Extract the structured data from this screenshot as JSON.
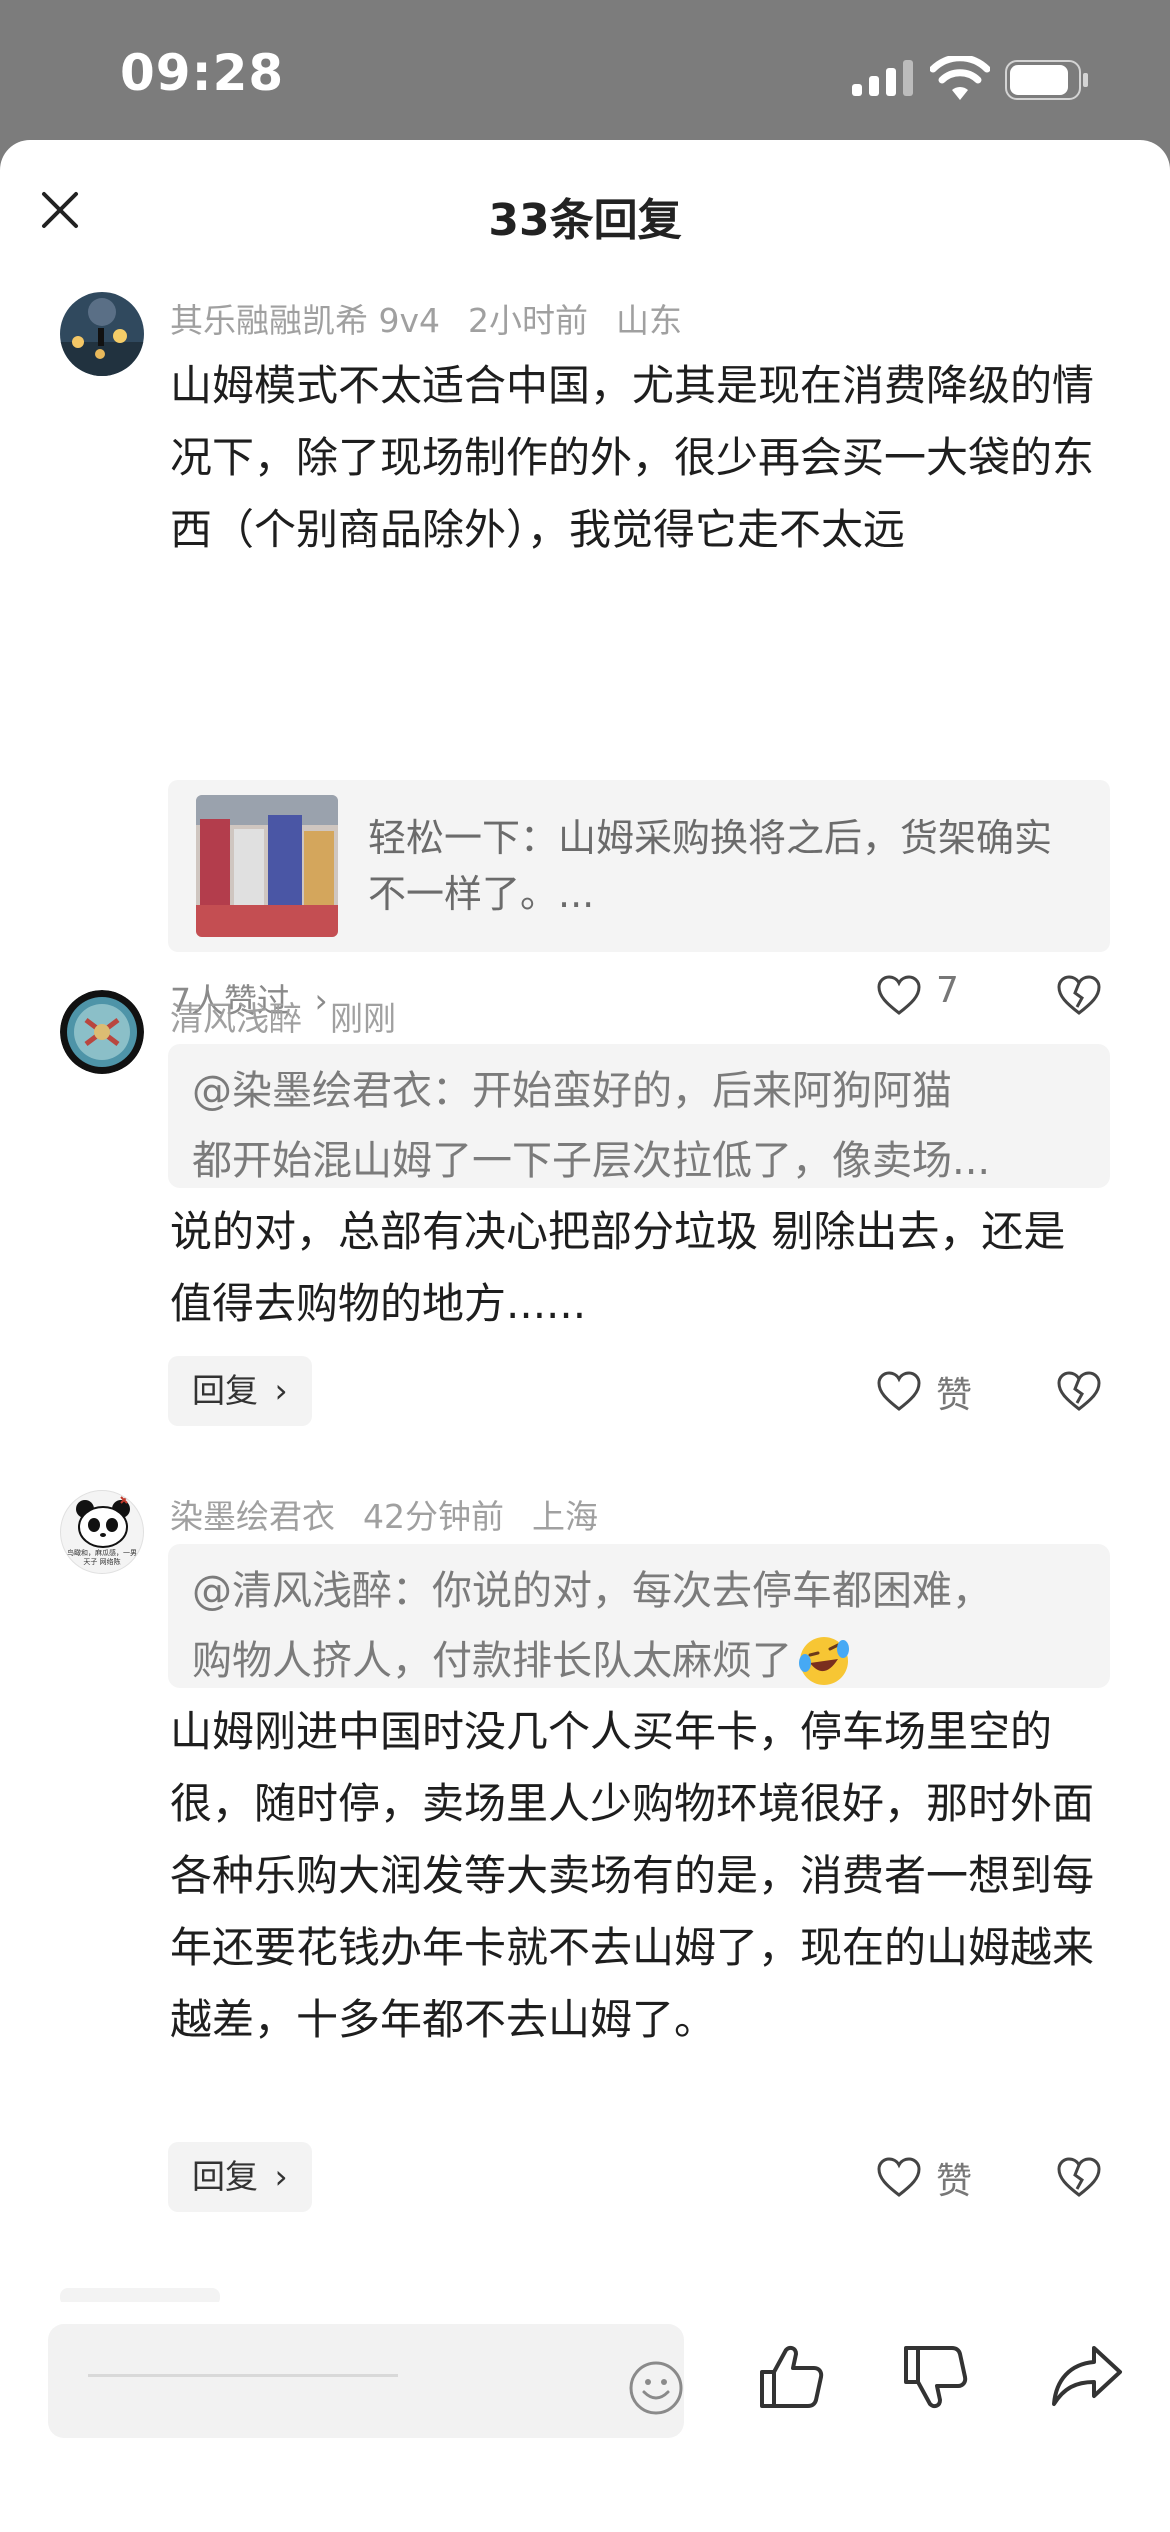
{
  "status_bar": {
    "time": "09:28"
  },
  "header": {
    "title": "33条回复"
  },
  "comments": [
    {
      "author": "其乐融融凯希 9v4",
      "time": "2小时前",
      "location": "山东",
      "text": "山姆模式不太适合中国，尤其是现在消费降级的情况下，除了现场制作的外，很少再会买一大袋的东西（个别商品除外），我觉得它走不太远",
      "link_card": {
        "title": "轻松一下：山姆采购换将之后，货架确实不一样了。..."
      },
      "liked_by": "7人赞过",
      "like_count": "7"
    },
    {
      "author": "清风浅醉",
      "time": "刚刚",
      "quote_line1": "@染墨绘君衣：开始蛮好的，后来阿狗阿猫",
      "quote_line2": "都开始混山姆了一下子层次拉低了，像卖场...",
      "text": "说的对，总部有决心把部分垃圾 剔除出去，还是值得去购物的地方......",
      "reply_label": "回复",
      "like_label": "赞"
    },
    {
      "author": "染墨绘君衣",
      "time": "42分钟前",
      "location": "上海",
      "quote_line1": "@清风浅醉：你说的对，每次去停车都困难，",
      "quote_line2": "购物人挤人，付款排长队太麻烦了",
      "avatar_text": "鸟瞰和，麻瓜感，一男天子 网络陈",
      "text": "山姆刚进中国时没几个人买年卡，停车场里空的很，随时停，卖场里人少购物环境很好，那时外面各种乐购大润发等大卖场有的是，消费者一想到每年还要花钱办年卡就不去山姆了，现在的山姆越来越差，十多年都不去山姆了。",
      "reply_label": "回复",
      "like_label": "赞"
    }
  ]
}
